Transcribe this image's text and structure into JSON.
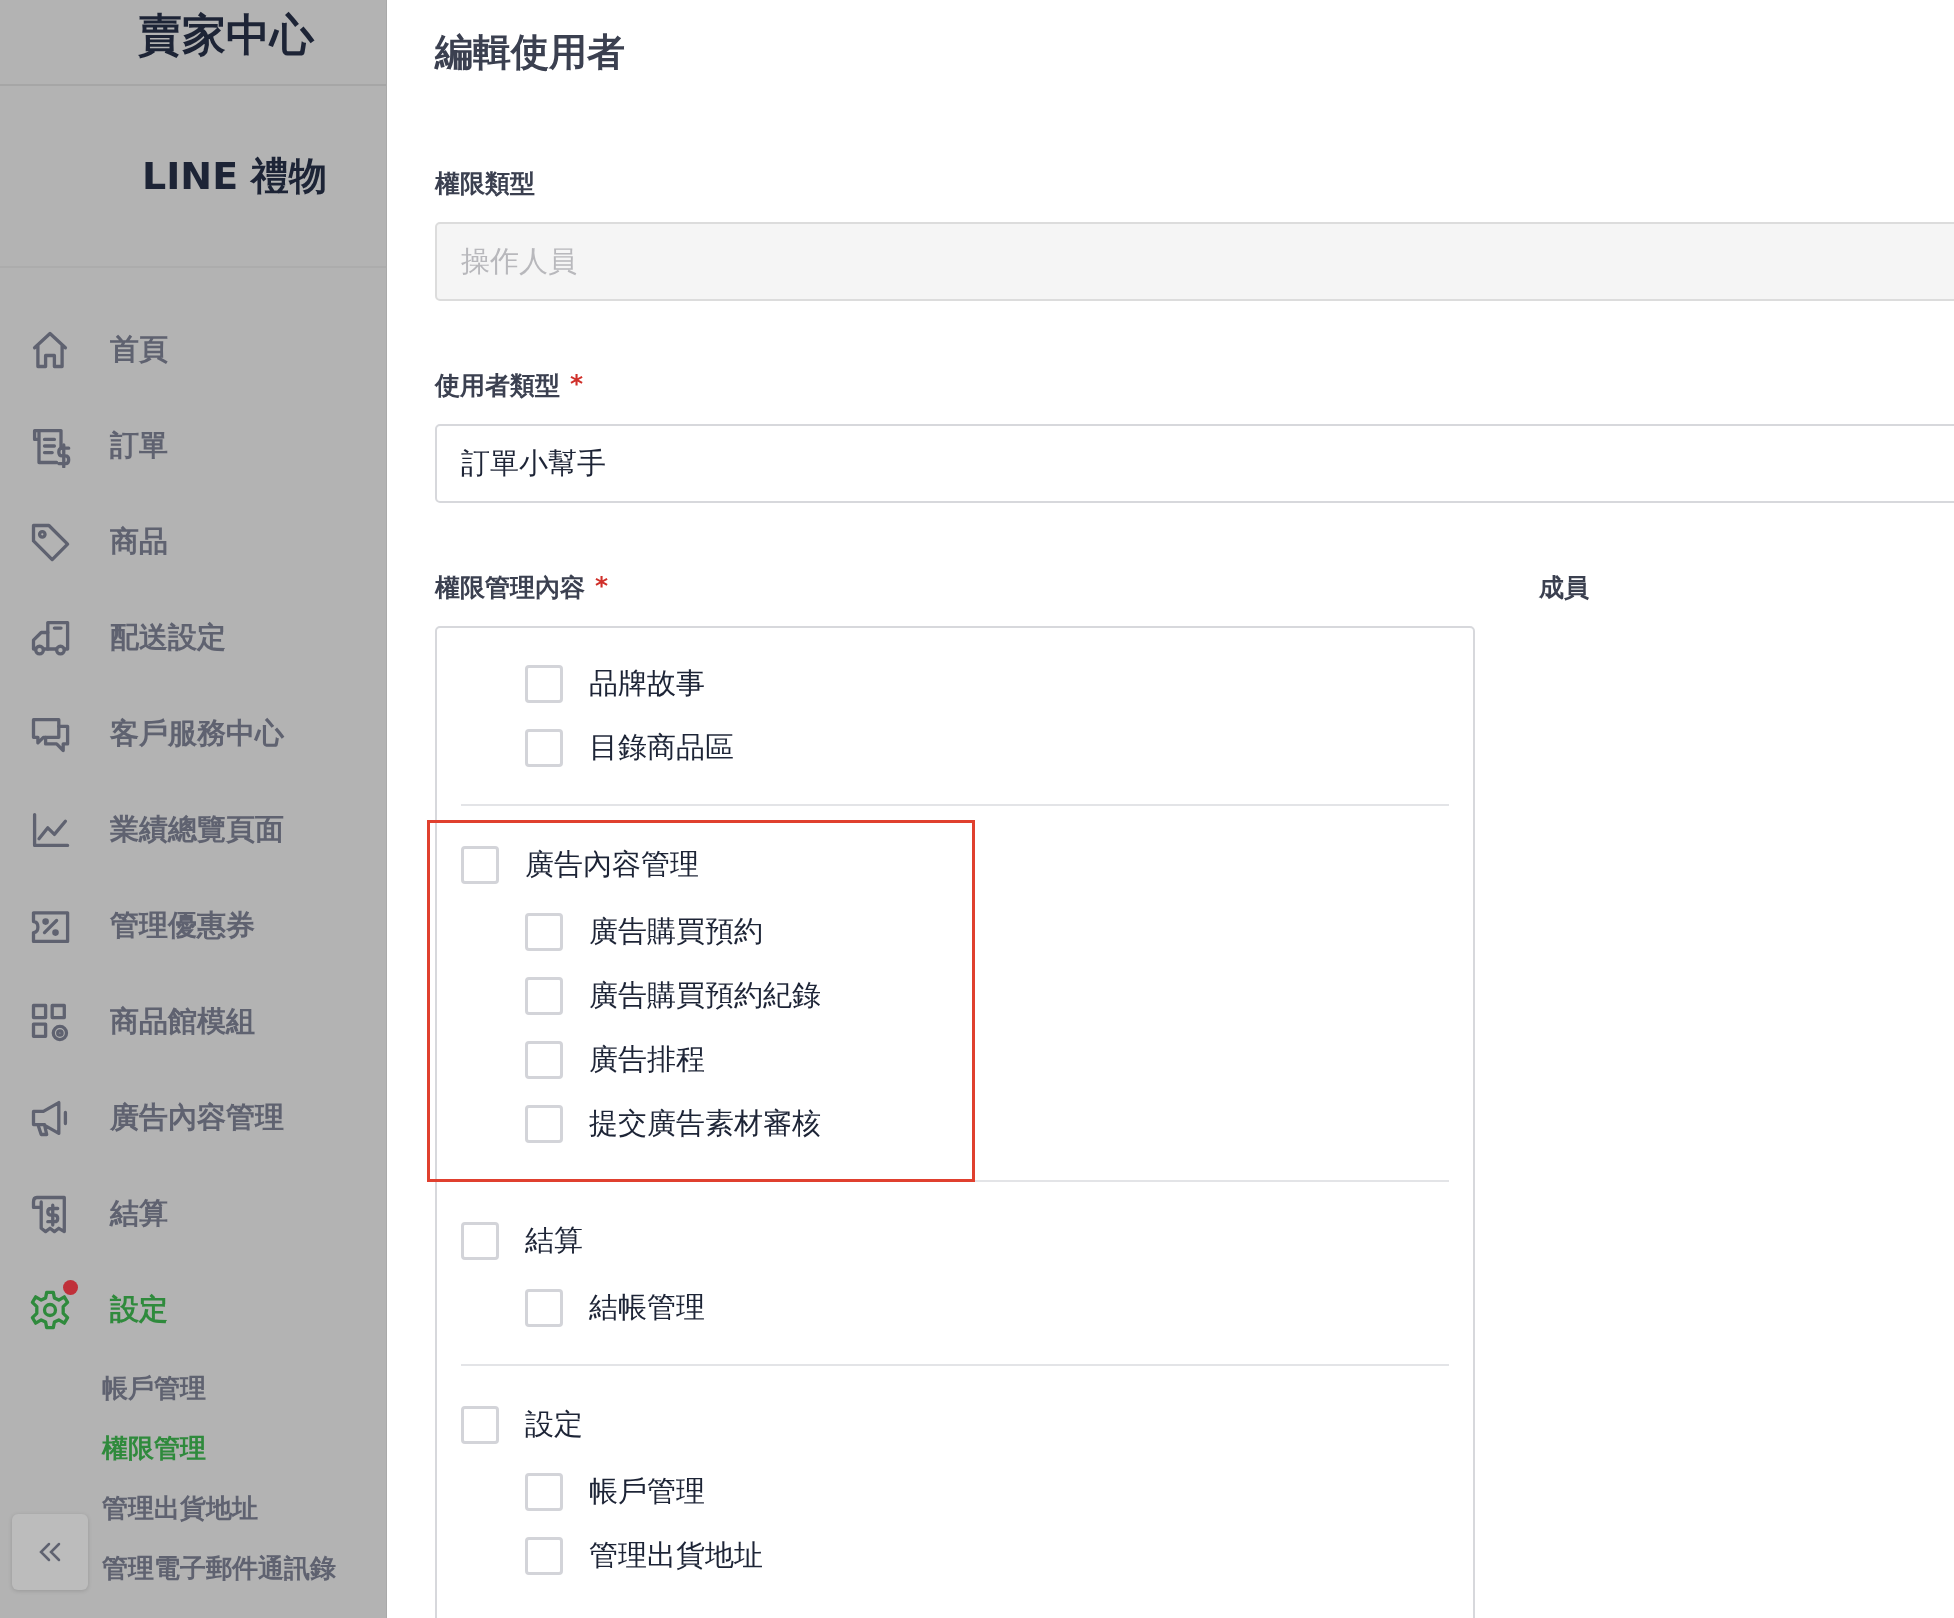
{
  "sidebar": {
    "title": "賣家中心",
    "brand": "LINE 禮物",
    "items": [
      {
        "label": "首頁",
        "selected": false,
        "badge": false
      },
      {
        "label": "訂單",
        "selected": false,
        "badge": false
      },
      {
        "label": "商品",
        "selected": false,
        "badge": false
      },
      {
        "label": "配送設定",
        "selected": false,
        "badge": false
      },
      {
        "label": "客戶服務中心",
        "selected": false,
        "badge": false
      },
      {
        "label": "業績總覽頁面",
        "selected": false,
        "badge": false
      },
      {
        "label": "管理優惠券",
        "selected": false,
        "badge": false
      },
      {
        "label": "商品館模組",
        "selected": false,
        "badge": false
      },
      {
        "label": "廣告內容管理",
        "selected": false,
        "badge": false
      },
      {
        "label": "結算",
        "selected": false,
        "badge": false
      },
      {
        "label": "設定",
        "selected": true,
        "badge": true,
        "children": [
          {
            "label": "帳戶管理",
            "selected": false
          },
          {
            "label": "權限管理",
            "selected": true
          },
          {
            "label": "管理出貨地址",
            "selected": false
          },
          {
            "label": "管理電子郵件通訊錄",
            "selected": false
          }
        ]
      }
    ]
  },
  "page": {
    "title": "編輯使用者",
    "fields": [
      {
        "label": "權限類型",
        "value": "操作人員",
        "disabled": true
      },
      {
        "label": "使用者類型",
        "required_mark": "*",
        "value": "訂單小幫手",
        "disabled": false
      }
    ],
    "permissions": {
      "label": "權限管理內容",
      "required_mark": "*",
      "members_label": "成員",
      "groups": [
        {
          "highlighted": false,
          "children": [
            {
              "label": "品牌故事",
              "checked": false
            },
            {
              "label": "目錄商品區",
              "checked": false
            }
          ]
        },
        {
          "highlighted": true,
          "parent": {
            "label": "廣告內容管理",
            "checked": false
          },
          "children": [
            {
              "label": "廣告購買預約",
              "checked": false
            },
            {
              "label": "廣告購買預約紀錄",
              "checked": false
            },
            {
              "label": "廣告排程",
              "checked": false
            },
            {
              "label": "提交廣告素材審核",
              "checked": false
            }
          ]
        },
        {
          "highlighted": false,
          "parent": {
            "label": "結算",
            "checked": false
          },
          "children": [
            {
              "label": "結帳管理",
              "checked": false
            }
          ]
        },
        {
          "highlighted": false,
          "parent": {
            "label": "設定",
            "checked": false
          },
          "children": [
            {
              "label": "帳戶管理",
              "checked": false
            },
            {
              "label": "管理出貨地址",
              "checked": false
            }
          ]
        }
      ]
    }
  }
}
